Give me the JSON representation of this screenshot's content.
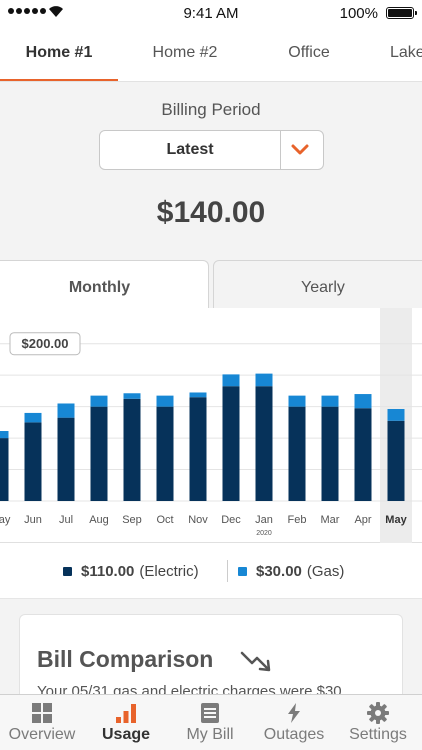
{
  "status_bar": {
    "time": "9:41 AM",
    "battery": "100%"
  },
  "home_tabs": [
    {
      "label": "Home #1",
      "active": true
    },
    {
      "label": "Home #2",
      "active": false
    },
    {
      "label": "Office",
      "active": false
    },
    {
      "label": "Lake",
      "active": false
    }
  ],
  "billing": {
    "label": "Billing Period",
    "selected": "Latest",
    "total": "$140.00"
  },
  "period_tabs": {
    "monthly": "Monthly",
    "yearly": "Yearly",
    "active": "monthly"
  },
  "chart_data": {
    "type": "bar",
    "stacked": true,
    "categories": [
      "May",
      "Jun",
      "Jul",
      "Aug",
      "Sep",
      "Oct",
      "Nov",
      "Dec",
      "Jan",
      "Feb",
      "Mar",
      "Apr",
      "May"
    ],
    "category_sublabels": {
      "8": "2020"
    },
    "selected_index": 12,
    "series": [
      {
        "name": "Electric",
        "values": [
          80,
          100,
          106,
          120,
          130,
          120,
          132,
          146,
          146,
          120,
          120,
          118,
          102
        ]
      },
      {
        "name": "Gas",
        "values": [
          9,
          12,
          18,
          14,
          7,
          14,
          6,
          15,
          16,
          14,
          14,
          18,
          15
        ]
      }
    ],
    "colors": {
      "Electric": "#06325a",
      "Gas": "#1787d4"
    },
    "ylim": [
      0,
      220
    ],
    "yticks": [
      40,
      80,
      120,
      160,
      200
    ],
    "y_marker": {
      "value": 200,
      "label": "$200.00"
    },
    "grid": true
  },
  "legend": {
    "electric": {
      "amount": "$110.00",
      "label": "(Electric)",
      "color": "#06325a"
    },
    "gas": {
      "amount": "$30.00",
      "label": "(Gas)",
      "color": "#1787d4"
    }
  },
  "comparison": {
    "title": "Bill Comparison",
    "text": "Your 05/31 gas and electric charges were $30"
  },
  "bottom_nav": [
    {
      "label": "Overview",
      "icon": "grid-icon",
      "active": false
    },
    {
      "label": "Usage",
      "icon": "bar-chart-icon",
      "active": true
    },
    {
      "label": "My Bill",
      "icon": "bill-icon",
      "active": false
    },
    {
      "label": "Outages",
      "icon": "lightning-icon",
      "active": false
    },
    {
      "label": "Settings",
      "icon": "gear-icon",
      "active": false
    }
  ],
  "accent_color": "#e8632b"
}
